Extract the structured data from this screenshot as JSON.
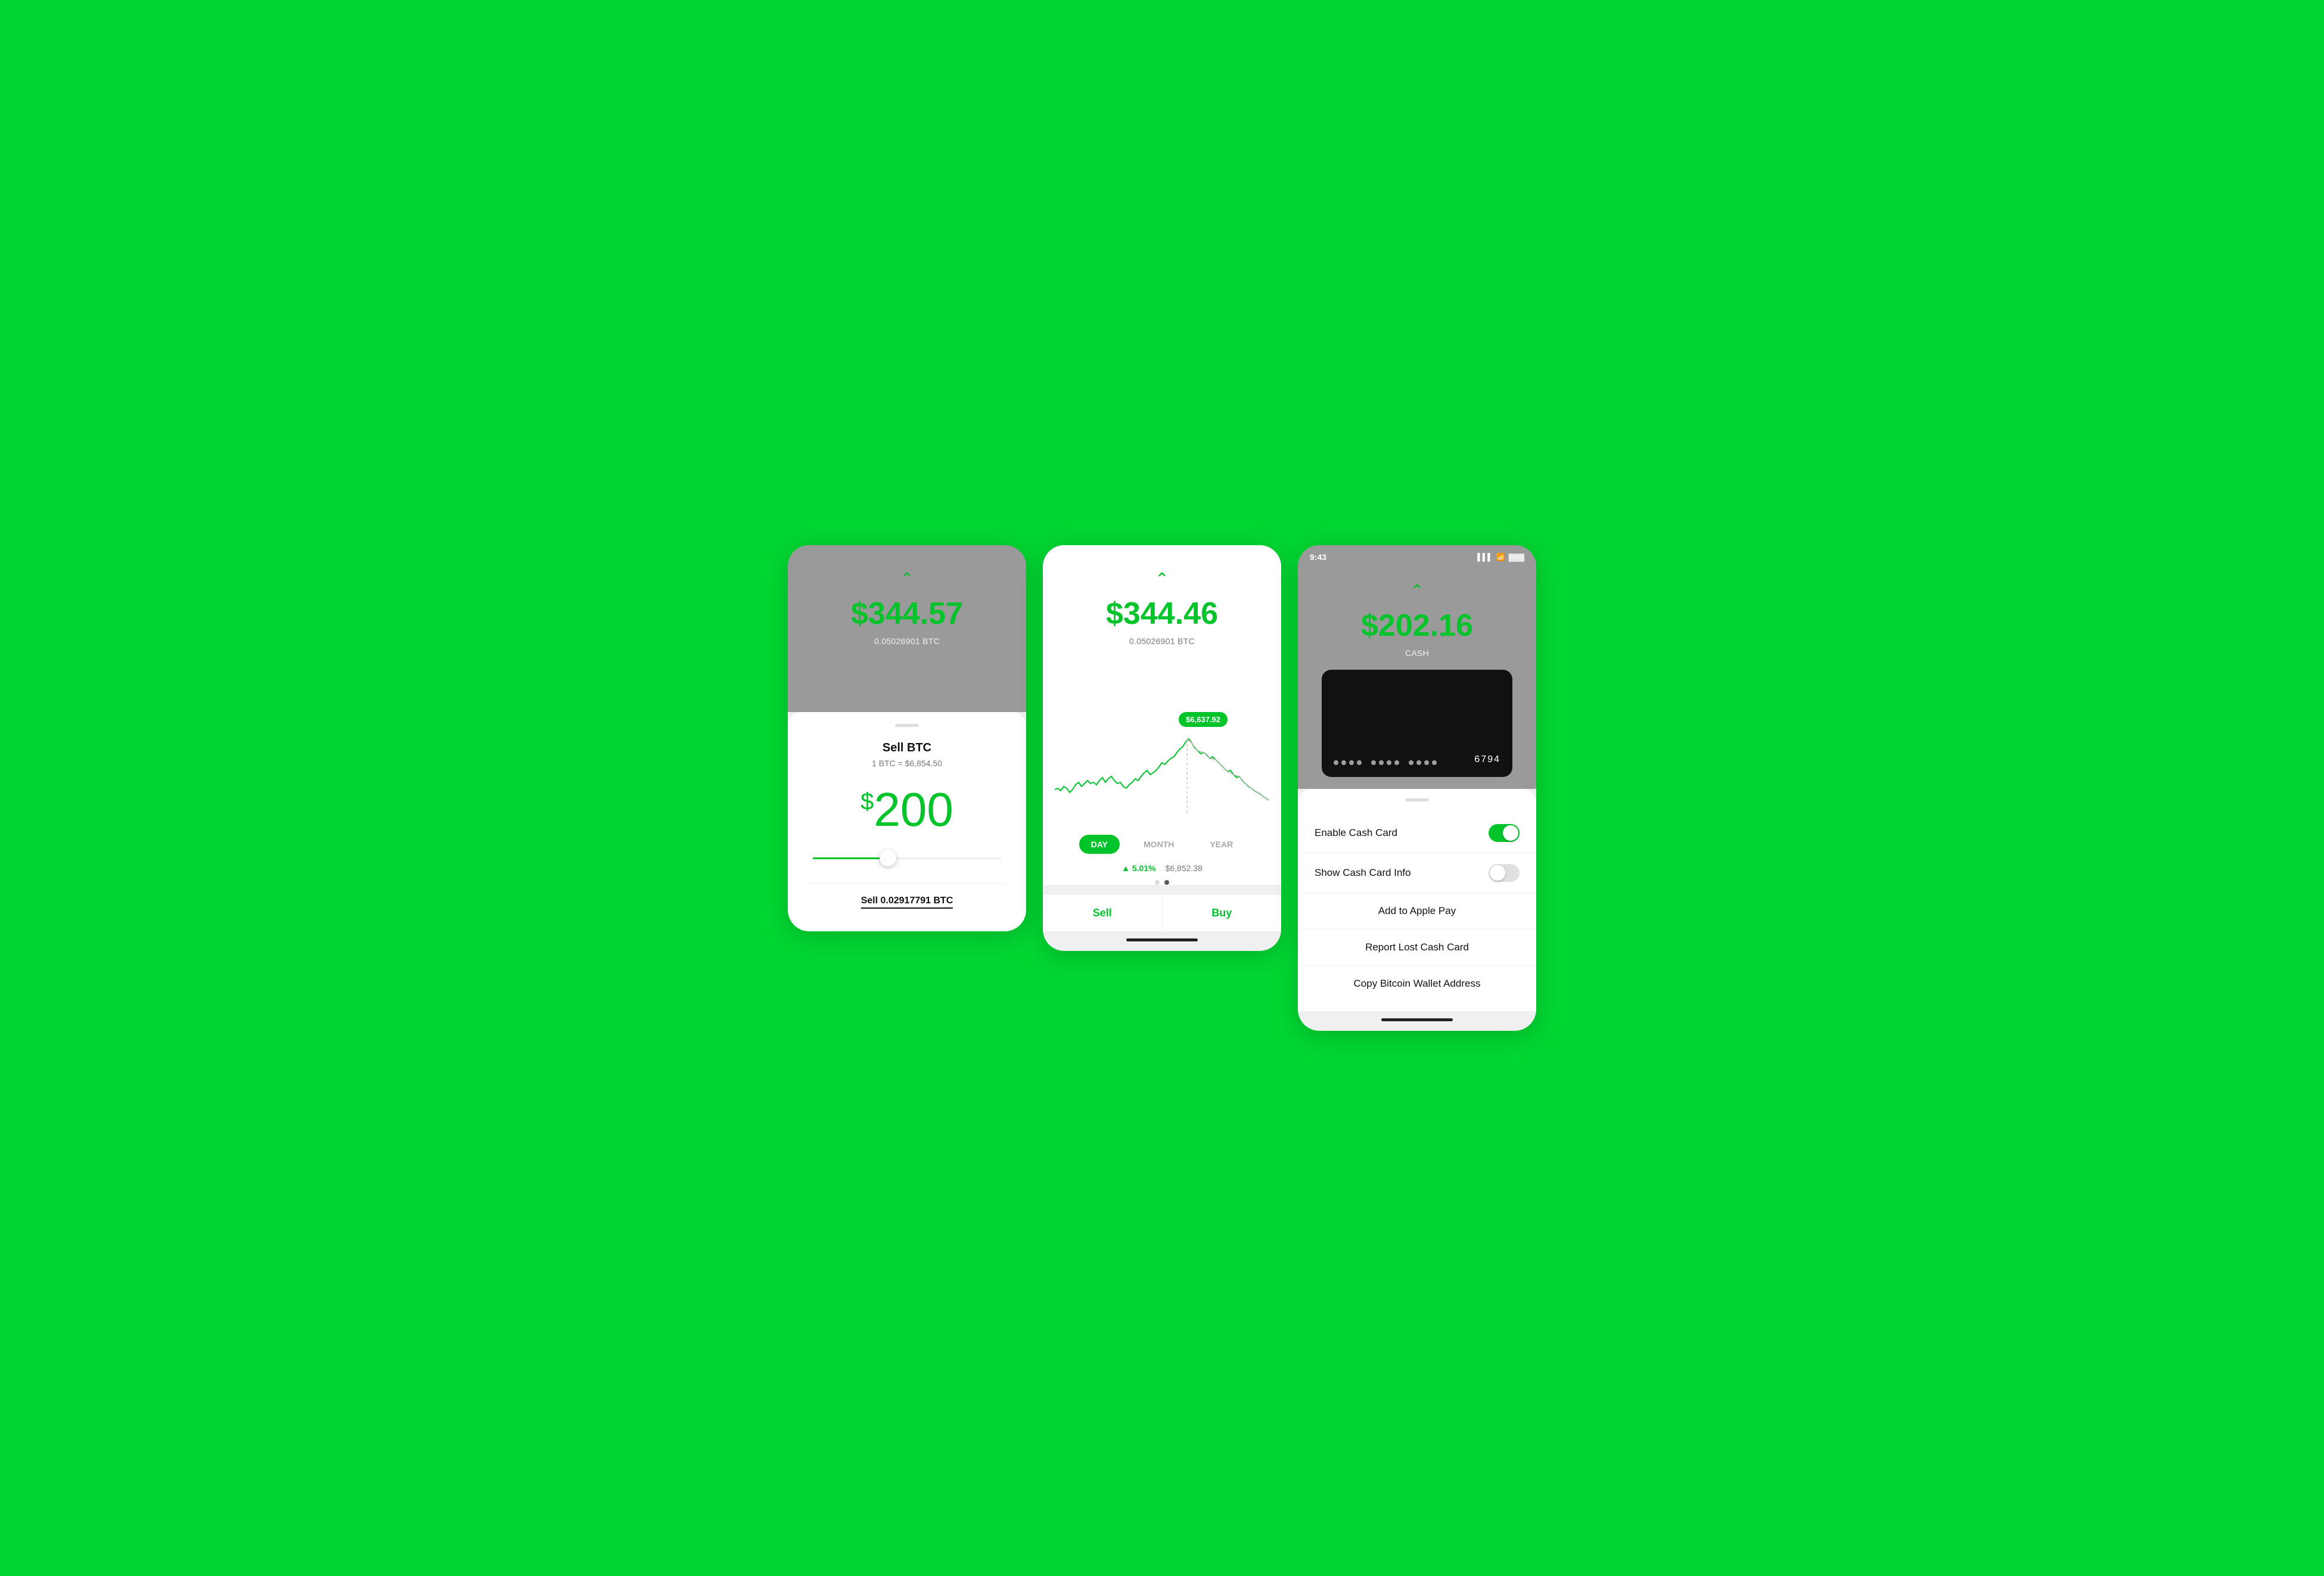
{
  "app": {
    "background_color": "#00D632"
  },
  "screen1": {
    "balance": "$344.57",
    "balance_btc": "0.05026901 BTC",
    "sheet_title": "Sell BTC",
    "sheet_subtitle": "1 BTC = $6,854.50",
    "sell_amount": "$200",
    "footer_text": "Sell 0.02917791 BTC",
    "slider_percent": 40
  },
  "screen2": {
    "balance": "$344.46",
    "balance_btc": "0.05026901 BTC",
    "tooltip_price": "$6,637.92",
    "tabs": [
      "DAY",
      "MONTH",
      "YEAR"
    ],
    "active_tab": "DAY",
    "stat_change": "▲ 5.01%",
    "stat_price": "$6,852.38",
    "sell_label": "Sell",
    "buy_label": "Buy"
  },
  "screen3": {
    "status_time": "9:43",
    "balance": "$202.16",
    "balance_label": "CASH",
    "card_number": "6794",
    "enable_label": "Enable Cash Card",
    "show_info_label": "Show Cash Card Info",
    "apple_pay_label": "Add to Apple Pay",
    "report_lost_label": "Report Lost Cash Card",
    "btc_wallet_label": "Copy Bitcoin Wallet Address"
  }
}
